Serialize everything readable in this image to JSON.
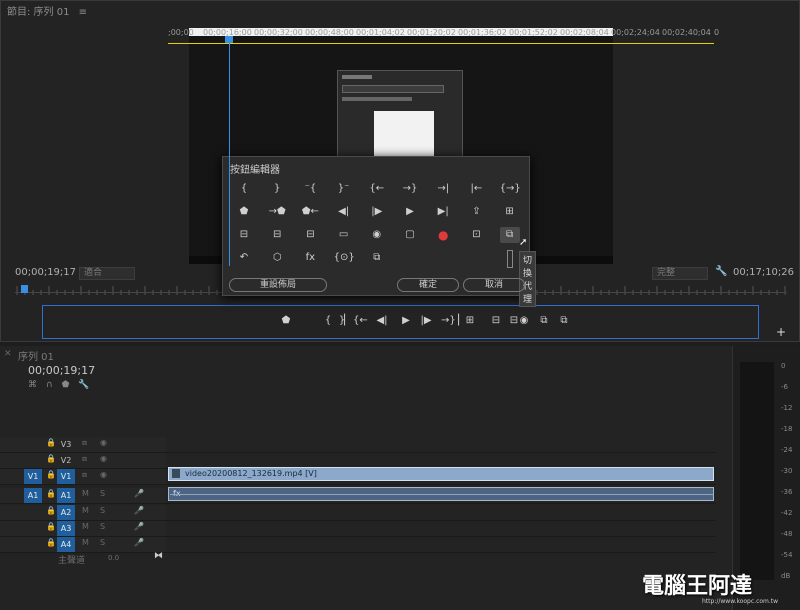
{
  "monitor": {
    "header": "節目: 序列 01",
    "menu_icon": "≡",
    "timecode_left": "00;00;19;17",
    "fit_label": "適合",
    "quality_label": "完整",
    "timecode_right": "00;17;10;26",
    "add_button": "+",
    "controls": [
      "⬟",
      "{",
      "}",
      "▏",
      "{←",
      "◀|",
      "▶",
      "|▶",
      "→}",
      "▏",
      "⊞",
      "⊟",
      "⊟",
      "◉",
      "⧉",
      "⧉"
    ]
  },
  "editor": {
    "title": "按鈕編輯器",
    "rows": [
      [
        "{",
        "}",
        "⁻{",
        "}⁻",
        "{←",
        "→}",
        "→|",
        "|←",
        "{→}"
      ],
      [
        "⬟",
        "→⬟",
        "⬟←",
        "◀|",
        "|▶",
        "▶",
        "▶|",
        "⇪",
        "⊞"
      ],
      [
        "⊟",
        "⊟",
        "⊟",
        "▭",
        "◉",
        "▢",
        "●",
        "⊡",
        "⧉"
      ],
      [
        "↶",
        "⬡",
        "fx",
        "{⊙}",
        "⧉"
      ]
    ],
    "tooltip": "切換代理",
    "reset_button": "重設佈局",
    "ok_button": "確定",
    "cancel_button": "取消"
  },
  "timeline": {
    "tab": "序列 01",
    "timecode": "00;00;19;17",
    "ruler": [
      ";00;00",
      "00;00;16;00",
      "00;00;32;00",
      "00;00;48;00",
      "00;01;04;02",
      "00;01;20;02",
      "00;01;36;02",
      "00;01;52;02",
      "00;02;08;04",
      "00;02;24;04",
      "00;02;40;04",
      "0"
    ],
    "tracks": [
      {
        "name": "V3",
        "src": ""
      },
      {
        "name": "V2",
        "src": ""
      },
      {
        "name": "V1",
        "src": "V1"
      },
      {
        "name": "A1",
        "src": "A1"
      },
      {
        "name": "A2",
        "src": ""
      },
      {
        "name": "A3",
        "src": ""
      },
      {
        "name": "A4",
        "src": ""
      }
    ],
    "master_label": "主聲道",
    "master_value": "0.0",
    "video_clip": "video20200812_132619.mp4 [V]",
    "audio_clip": "fx"
  },
  "meter": {
    "ticks": [
      "0",
      "-6",
      "-12",
      "-18",
      "-24",
      "-30",
      "-36",
      "-42",
      "-48",
      "-54",
      "dB"
    ]
  },
  "watermark": {
    "text": "電腦王阿達",
    "url": "http://www.koopc.com.tw"
  }
}
